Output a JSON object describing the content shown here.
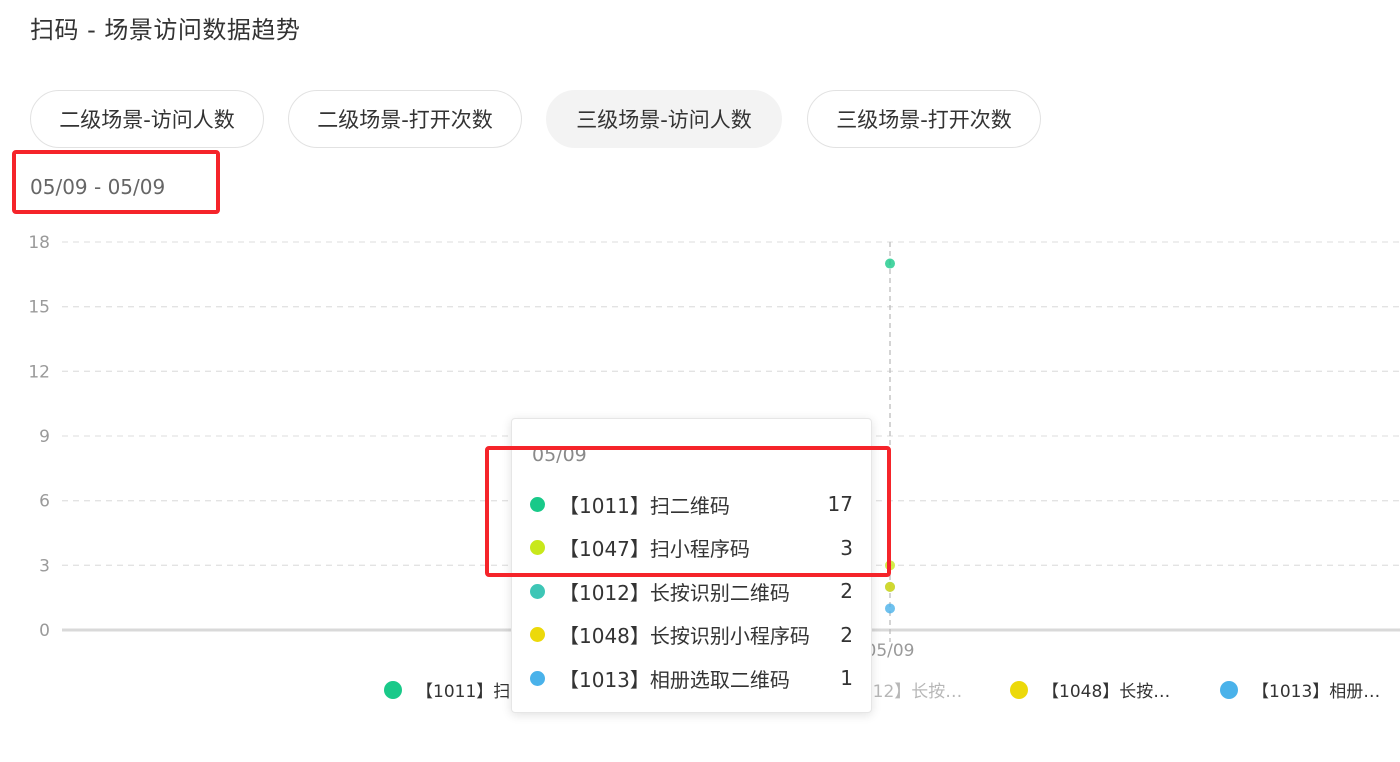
{
  "header": {
    "title": "扫码 - 场景访问数据趋势"
  },
  "tabs": [
    {
      "label": "二级场景-访问人数",
      "active": false
    },
    {
      "label": "二级场景-打开次数",
      "active": false
    },
    {
      "label": "三级场景-访问人数",
      "active": true
    },
    {
      "label": "三级场景-打开次数",
      "active": false
    }
  ],
  "date_range": "05/09 - 05/09",
  "colors": {
    "highlight_box": "#f5242a",
    "grid": "#dddddd"
  },
  "chart_data": {
    "type": "scatter",
    "x": [
      "05/09"
    ],
    "ylim": [
      0,
      18
    ],
    "yticks": [
      "0",
      "3",
      "6",
      "9",
      "12",
      "15",
      "18"
    ],
    "grid": true,
    "legend_position": "bottom",
    "series": [
      {
        "name": "【1011】扫二维码",
        "legend_label": "【1011】扫二…",
        "values": [
          17
        ],
        "color": "#19c989",
        "legend_faded": false
      },
      {
        "name": "【1047】扫小程序码",
        "legend_label": "【1047】扫小…",
        "values": [
          3
        ],
        "color": "#c8e81b",
        "legend_faded": true
      },
      {
        "name": "【1012】长按识别二维码",
        "legend_label": "【1012】长按…",
        "values": [
          2
        ],
        "color": "#3ec6b6",
        "legend_faded": true
      },
      {
        "name": "【1048】长按识别小程序码",
        "legend_label": "【1048】长按…",
        "values": [
          2
        ],
        "color": "#ecd90a",
        "legend_faded": false
      },
      {
        "name": "【1013】相册选取二维码",
        "legend_label": "【1013】相册…",
        "values": [
          1
        ],
        "color": "#4ab2ea",
        "legend_faded": false
      }
    ]
  },
  "tooltip": {
    "title": "05/09",
    "rows": [
      {
        "name": "【1011】扫二维码",
        "value": "17",
        "color": "#19c989"
      },
      {
        "name": "【1047】扫小程序码",
        "value": "3",
        "color": "#c8e81b"
      },
      {
        "name": "【1012】长按识别二维码",
        "value": "2",
        "color": "#3ec6b6"
      },
      {
        "name": "【1048】长按识别小程序码",
        "value": "2",
        "color": "#ecd90a"
      },
      {
        "name": "【1013】相册选取二维码",
        "value": "1",
        "color": "#4ab2ea"
      }
    ]
  }
}
